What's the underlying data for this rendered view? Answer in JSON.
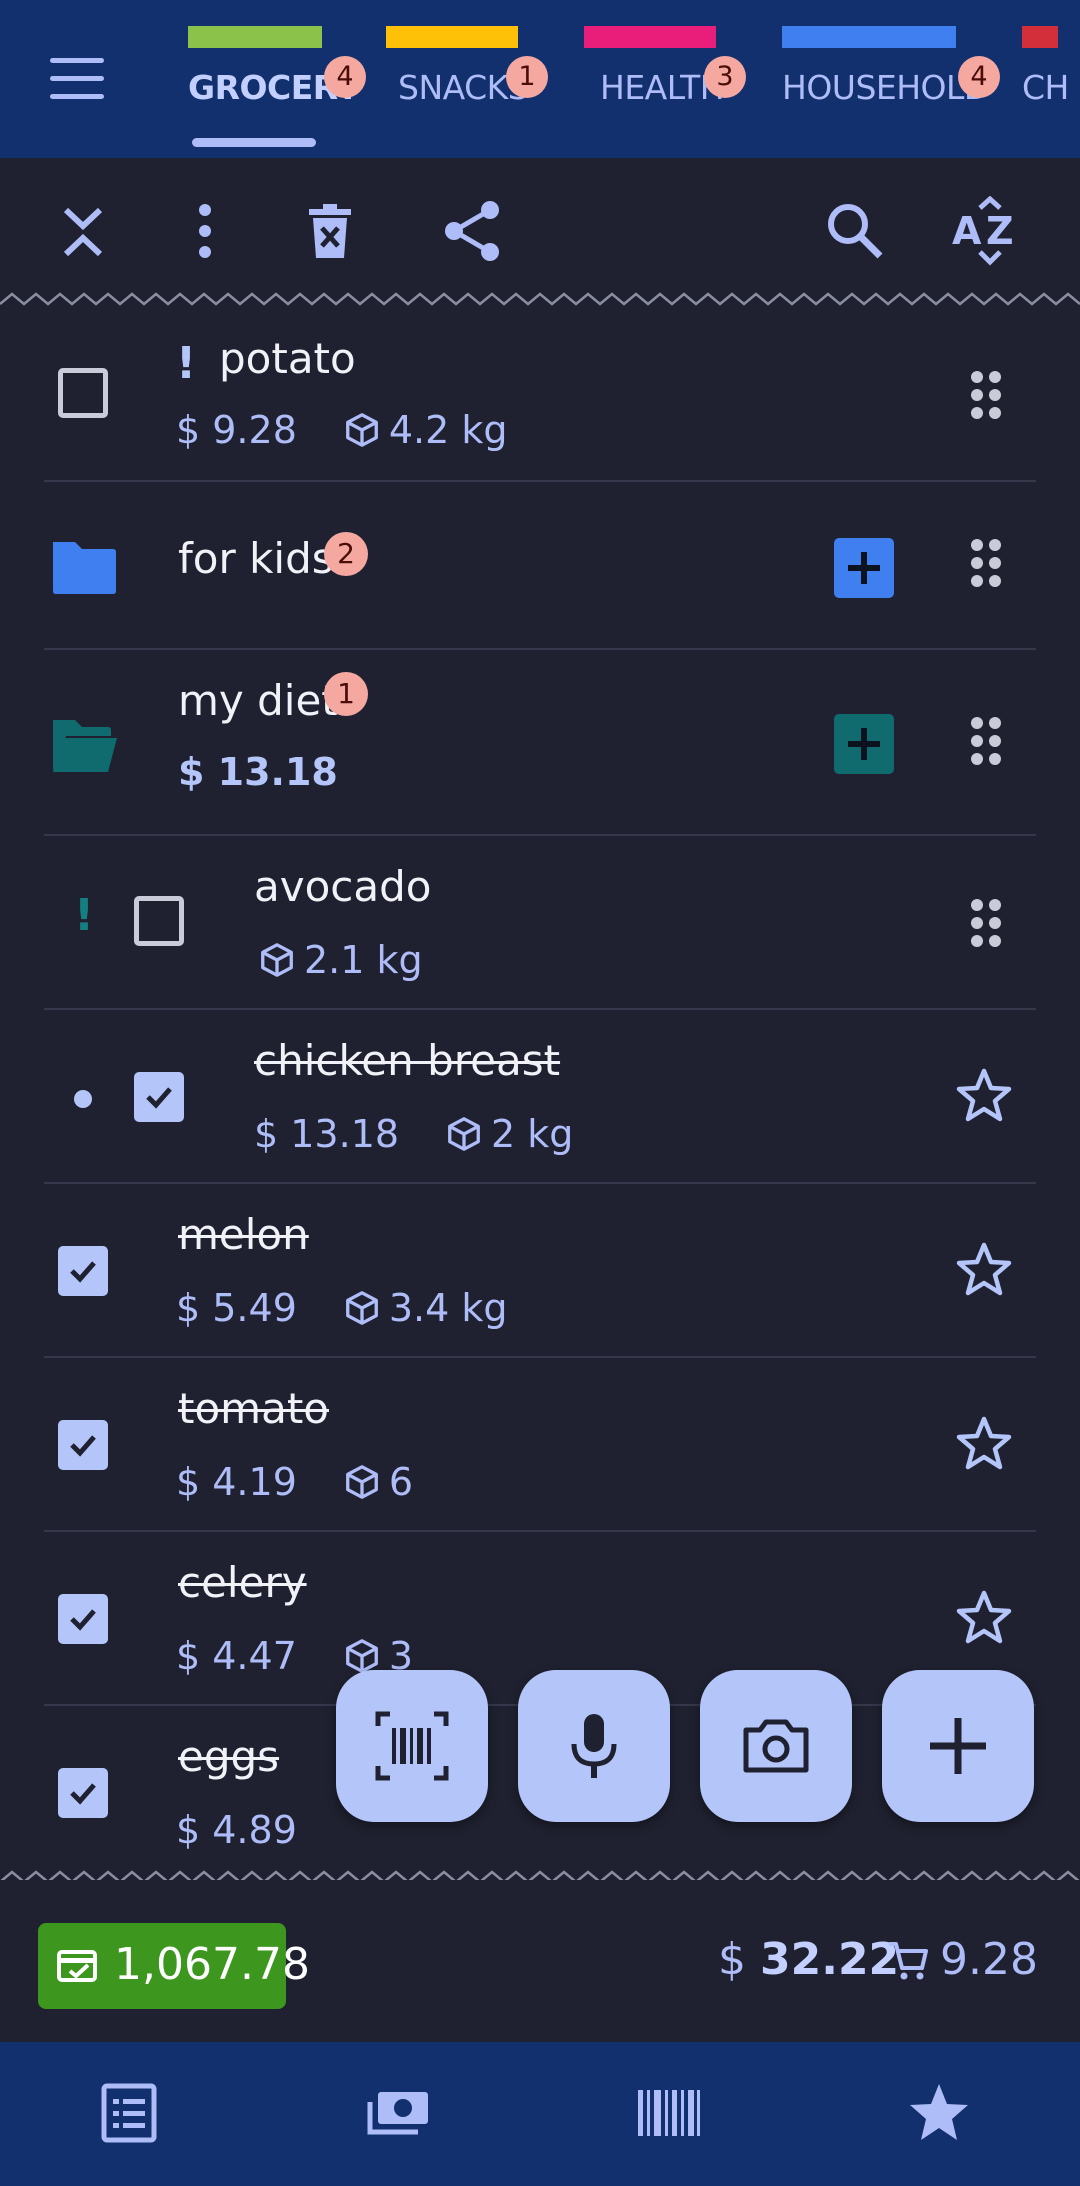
{
  "tabs": [
    {
      "label": "GROCERY",
      "badge": "4",
      "color": "#8bc34a",
      "active": true
    },
    {
      "label": "SNACKS",
      "badge": "1",
      "color": "#ffc107"
    },
    {
      "label": "HEALTH",
      "badge": "3",
      "color": "#e91e7a"
    },
    {
      "label": "HOUSEHOLD",
      "badge": "4",
      "color": "#3f7ff0"
    },
    {
      "label": "CH",
      "badge": "",
      "color": "#d32f3a"
    }
  ],
  "toolbar": {
    "icons": [
      "collapse-icon",
      "more-vert-icon",
      "delete-checked-icon",
      "share-icon",
      "search-icon",
      "sort-az-icon"
    ]
  },
  "items": {
    "potato": {
      "name": "potato",
      "price": "$ 9.28",
      "qty": "4.2 kg",
      "important": "!"
    },
    "for_kids": {
      "name": "for kids",
      "badge": "2"
    },
    "my_diet": {
      "name": "my diet",
      "badge": "1",
      "total": "$ 13.18"
    },
    "avocado": {
      "name": "avocado",
      "qty": "2.1 kg",
      "important": "!"
    },
    "chicken": {
      "name": "chicken breast",
      "price": "$ 13.18",
      "qty": "2 kg"
    },
    "melon": {
      "name": "melon",
      "price": "$ 5.49",
      "qty": "3.4 kg"
    },
    "tomato": {
      "name": "tomato",
      "price": "$ 4.19",
      "qty": "6"
    },
    "celery": {
      "name": "celery",
      "price": "$ 4.47",
      "qty": "3"
    },
    "eggs": {
      "name": "eggs",
      "price": "$ 4.89"
    }
  },
  "fabs": [
    "barcode-icon",
    "microphone-icon",
    "camera-icon",
    "add-icon"
  ],
  "summary": {
    "balance": "1,067.78",
    "total_currency": "$",
    "total_value": "32.22",
    "cart_value": "9.28"
  },
  "bottom_nav": [
    "list-icon",
    "money-icon",
    "barcode-icon",
    "star-icon"
  ],
  "colors": {
    "accent": "#b4c5f9",
    "header": "#12306e",
    "background": "#1f2130",
    "folder_blue": "#3f7ff0",
    "folder_teal": "#0f6b6e",
    "balance_green": "#3d961e"
  }
}
